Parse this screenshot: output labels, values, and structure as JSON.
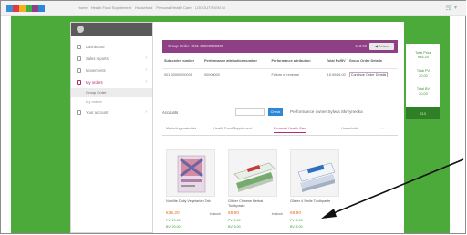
{
  "topbar": {
    "breadcrumbs": [
      "Home",
      "Health Food Supplement",
      "Household",
      "Personal Health Care",
      "LOGOUT/SIGN IN"
    ],
    "logo_colors": [
      "#3a8fd8",
      "#e23b3b",
      "#f2b01e",
      "#3fae45",
      "#8f3f83",
      "#2e86d6"
    ],
    "icons": [
      "cart-icon",
      "user-icon"
    ]
  },
  "nav": {
    "items": [
      {
        "label": "Dashboard",
        "icon": "dashboard-icon"
      },
      {
        "label": "Sales reports",
        "icon": "report-icon",
        "chev": "›"
      },
      {
        "label": "Movements",
        "icon": "transfer-icon",
        "chev": "›"
      },
      {
        "label": "My orders",
        "icon": "orders-icon",
        "chev": "›",
        "active": true
      }
    ],
    "subitems": [
      "Group Order",
      "My orders"
    ],
    "footer_item": {
      "label": "Your account",
      "icon": "account-icon",
      "chev": "›"
    }
  },
  "order": {
    "title": "Group Order : 001-00000000000",
    "amount": "€13.90",
    "action_label": "◀ Return",
    "columns": [
      "Sub-order number",
      "Performance attribution number",
      "Performance attribution",
      "Total Pv/BV",
      "Group Order Details"
    ],
    "rows": [
      [
        "001-00000000001",
        "00000000",
        "Failure of renewal",
        "15.00/15.00",
        "Continue Order Details"
      ]
    ]
  },
  "filter": {
    "label": "Accounts",
    "button": "Check",
    "performance_text": "Performance owner Sylwia Skrzynecka"
  },
  "tabs": [
    "Marketing materials",
    "Health Food Supplement",
    "Personal Health Care",
    "Household",
    "‹  ›"
  ],
  "active_tab": 2,
  "products": [
    {
      "name": "Nutrilite Daily Vegetarian Tab",
      "price": "€35.20",
      "stock": "In stock",
      "pv": "PV: 20.00",
      "bv": "BV: 20.00"
    },
    {
      "name": "Glister Chinese Herbal Toothpaste",
      "price": "€8.90",
      "stock": "In stock",
      "pv": "PV: 5.00",
      "bv": "BV: 5.00"
    },
    {
      "name": "Glister 4 Smile Toothpaste",
      "price": "€8.90",
      "stock": "",
      "pv": "PV: 5.00",
      "bv": "BV: 5.00"
    }
  ],
  "summary": {
    "items": [
      {
        "label": "Total Price",
        "value": "€35.20"
      },
      {
        "label": "Total PV",
        "value": "20.00"
      },
      {
        "label": "Total BV",
        "value": "20.00"
      }
    ],
    "footer": "€13"
  }
}
